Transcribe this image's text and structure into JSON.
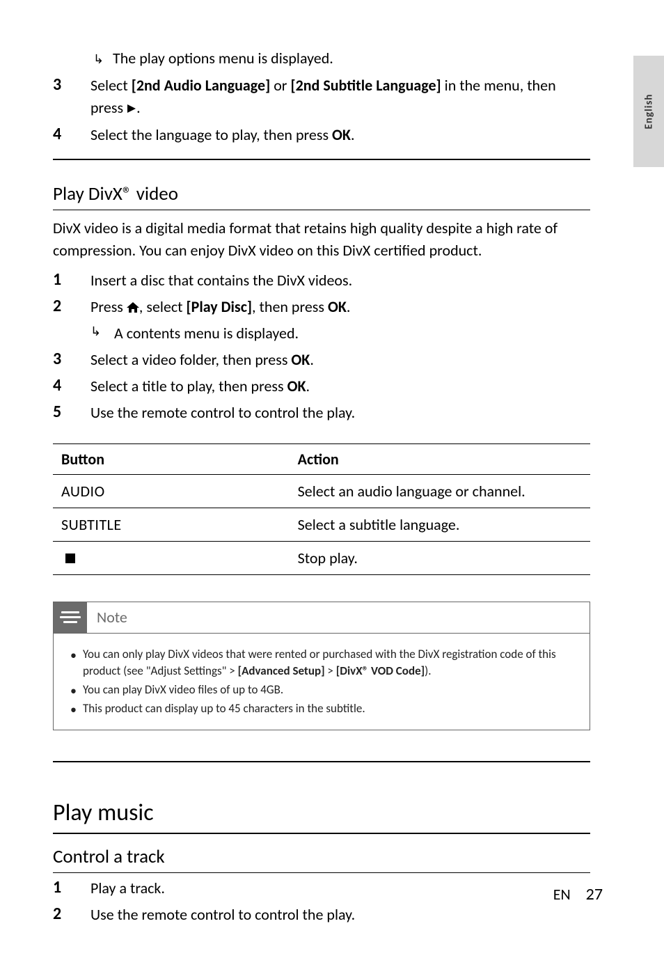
{
  "sideTab": "English",
  "topResult": "The play options menu is displayed.",
  "topSteps": [
    {
      "num": "3",
      "pre": "Select ",
      "b1": "[2nd Audio Language]",
      "mid": " or ",
      "b2": "[2nd Subtitle Language]",
      "post": " in the menu, then press ",
      "icon": "play"
    },
    {
      "num": "4",
      "pre": "Select the language to play, then press ",
      "b1": "OK",
      "post": "."
    }
  ],
  "divx": {
    "heading": "Play DivX® video",
    "intro": "DivX video is a digital media format that retains high quality despite a high rate of compression. You can enjoy DivX video on this DivX certified product.",
    "steps": [
      {
        "num": "1",
        "text": "Insert a disc that contains the DivX videos."
      },
      {
        "num": "2",
        "pre": "Press ",
        "icon": "home",
        "mid": ", select ",
        "b1": "[Play Disc]",
        "mid2": ", then press ",
        "b2": "OK",
        "post": ".",
        "result": "A contents menu is displayed."
      },
      {
        "num": "3",
        "pre": "Select a video folder, then press ",
        "b1": "OK",
        "post": "."
      },
      {
        "num": "4",
        "pre": "Select a title to play, then press ",
        "b1": "OK",
        "post": "."
      },
      {
        "num": "5",
        "text": "Use the remote control to control the play."
      }
    ]
  },
  "table": {
    "head": {
      "c1": "Button",
      "c2": "Action"
    },
    "rows": [
      {
        "btn": "AUDIO",
        "action": "Select an audio language or channel."
      },
      {
        "btn": "SUBTITLE",
        "action": "Select a subtitle language."
      },
      {
        "btn": "",
        "icon": "stop",
        "action": "Stop play."
      }
    ]
  },
  "note": {
    "title": "Note",
    "items": [
      {
        "pre": "You can only play DivX videos that were rented or purchased with the DivX registration code of this product (see \"Adjust Settings\" > ",
        "b1": "[Advanced Setup]",
        "mid": " > ",
        "b2": "[DivX® VOD Code]",
        "post": ")."
      },
      {
        "text": "You can play DivX video files of up to 4GB."
      },
      {
        "text": "This product can display up to 45 characters in the subtitle."
      }
    ]
  },
  "music": {
    "h1": "Play music",
    "h2": "Control a track",
    "steps": [
      {
        "num": "1",
        "text": "Play a track."
      },
      {
        "num": "2",
        "text": "Use the remote control to control the play."
      }
    ]
  },
  "footer": {
    "lang": "EN",
    "page": "27"
  }
}
